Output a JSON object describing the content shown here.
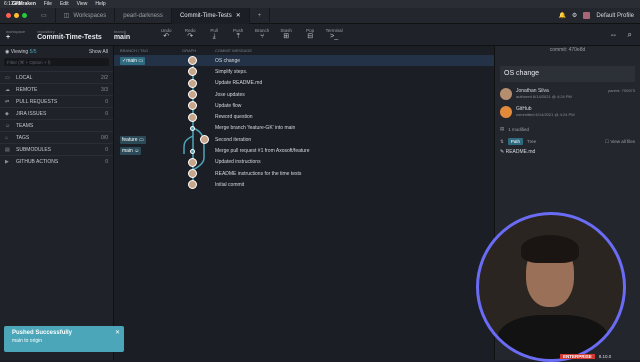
{
  "mac": {
    "app": "GitKraken",
    "menus": [
      "File",
      "Edit",
      "View",
      "Help"
    ],
    "time": "6:12 PM"
  },
  "tabs": {
    "workspaces": "Workspaces",
    "t1": "pearl-darkness",
    "t2": "Commit-Time-Tests",
    "profile": "Default Profile"
  },
  "toolbar": {
    "workspace_lbl": "workspace",
    "repository_lbl": "repository",
    "repository": "Commit-Time-Tests",
    "branch_lbl": "branch",
    "branch": "main",
    "actions": [
      "Undo",
      "Redo",
      "Pull",
      "Push",
      "Branch",
      "Stash",
      "Pop",
      "Terminal"
    ]
  },
  "sidebar": {
    "viewing": "Viewing",
    "viewing_count": "5/5",
    "show_all": "Show All",
    "filter_placeholder": "Filter (⌘ + Option + f)",
    "items": [
      {
        "label": "LOCAL",
        "count": "2/2"
      },
      {
        "label": "REMOTE",
        "count": "3/3"
      },
      {
        "label": "PULL REQUESTS",
        "count": "0"
      },
      {
        "label": "JIRA ISSUES",
        "count": "0"
      },
      {
        "label": "TEAMS",
        "count": ""
      },
      {
        "label": "TAGS",
        "count": "0/0"
      },
      {
        "label": "SUBMODULES",
        "count": "0"
      },
      {
        "label": "GITHUB ACTIONS",
        "count": "0"
      }
    ]
  },
  "graph": {
    "headers": [
      "BRANCH / TAG",
      "GRAPH",
      "COMMIT MESSAGE"
    ],
    "commits": [
      "OS change",
      "Simplify steps.",
      "Update README.md",
      "Jose updates",
      "Update flow",
      "Reword question",
      "Merge branch 'feature-GK' into main",
      "Second iteration",
      "Merge pull request #1 from Axosoft/feature",
      "Updated instructions",
      "README instructions for the time tests",
      "Initial commit"
    ],
    "refs": {
      "main": "main",
      "feature": "feature",
      "main2": "main"
    }
  },
  "panel": {
    "commit_label": "commit: 470e8d",
    "title": "OS change",
    "author": "Jonathan Silva",
    "authored": "authored 6/14/2021 @ 4:24 PM",
    "parent": "parent: 700973",
    "committer": "GitHub",
    "committed": "committed 6/14/2021 @ 4:24 PM",
    "modified": "1 modified",
    "path": "Path",
    "tree": "Tree",
    "view_all": "View all files",
    "file": "README.md"
  },
  "toast": {
    "title": "Pushed Successfully",
    "body": "main to origin"
  },
  "status": {
    "badge": "ENTERPRISE",
    "version": "8.10.0"
  }
}
